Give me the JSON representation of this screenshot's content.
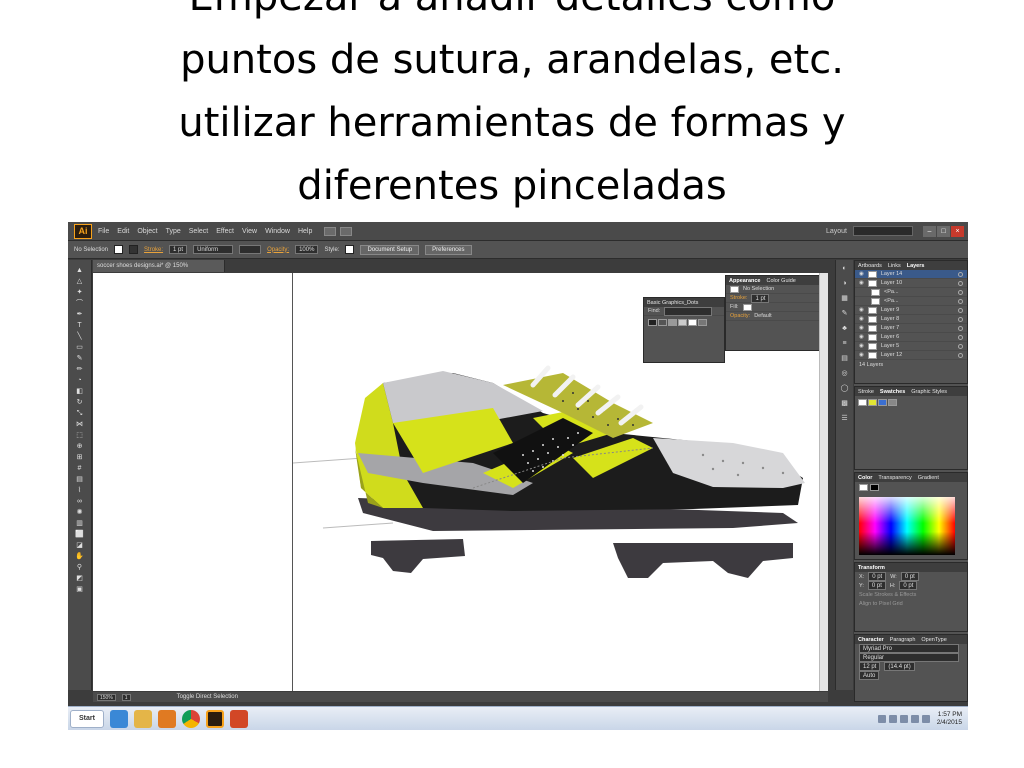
{
  "slide": {
    "title_lines": [
      "Empezar a añadir detalles como",
      "puntos de sutura, arandelas, etc.",
      "utilizar herramientas de formas y",
      "diferentes pinceladas"
    ]
  },
  "app": {
    "logo": "Ai",
    "menu": [
      "File",
      "Edit",
      "Object",
      "Type",
      "Select",
      "Effect",
      "View",
      "Window",
      "Help"
    ],
    "workspace_label": "Layout",
    "window_buttons": [
      "–",
      "□",
      "×"
    ]
  },
  "control_bar": {
    "selection": "No Selection",
    "stroke_label": "Stroke:",
    "stroke_value": "1 pt",
    "profile": "Uniform",
    "opacity_label": "Opacity:",
    "opacity_value": "100%",
    "style_label": "Style:",
    "document_setup": "Document Setup",
    "preferences": "Preferences"
  },
  "document": {
    "tab_title": "soccer shoes designs.ai* @ 150% (CMYK/Preview)"
  },
  "status_bar": {
    "zoom": "150%",
    "page": "1",
    "tool_hint": "Toggle Direct Selection"
  },
  "panels": {
    "graphics_dots": {
      "title": "Basic Graphics_Dots",
      "find_label": "Find:"
    },
    "appearance": {
      "tabs": [
        "Appearance",
        "Color Guide"
      ],
      "selection": "No Selection",
      "stroke_label": "Stroke:",
      "stroke_value": "1 pt",
      "fill_label": "Fill:",
      "opacity_label": "Opacity:",
      "opacity_value": "Default"
    },
    "layers": {
      "tabs": [
        "Artboards",
        "Links",
        "Layers"
      ],
      "rows": [
        "Layer 14",
        "Layer 10",
        "<Pa...",
        "<Pa...",
        "Layer 9",
        "Layer 8",
        "Layer 7",
        "Layer 6",
        "Layer 5",
        "Layer 12"
      ],
      "count": "14 Layers"
    },
    "swatches": {
      "tabs": [
        "Stroke",
        "Swatches",
        "Graphic Styles"
      ]
    },
    "color": {
      "tabs": [
        "Color",
        "Transparency",
        "Gradient"
      ]
    },
    "transform": {
      "title": "Transform",
      "x": "0 pt",
      "y": "0 pt",
      "w": "0 pt",
      "h": "0 pt",
      "scale_strokes": "Scale Strokes & Effects",
      "align_pixel": "Align to Pixel Grid"
    },
    "character": {
      "tabs": [
        "Character",
        "Paragraph",
        "OpenType"
      ],
      "font": "Myriad Pro",
      "style": "Regular",
      "size": "12 pt",
      "leading": "(14.4 pt)",
      "kerning": "Auto"
    }
  },
  "taskbar": {
    "start": "Start",
    "time": "1:57 PM",
    "date": "2/4/2015"
  }
}
